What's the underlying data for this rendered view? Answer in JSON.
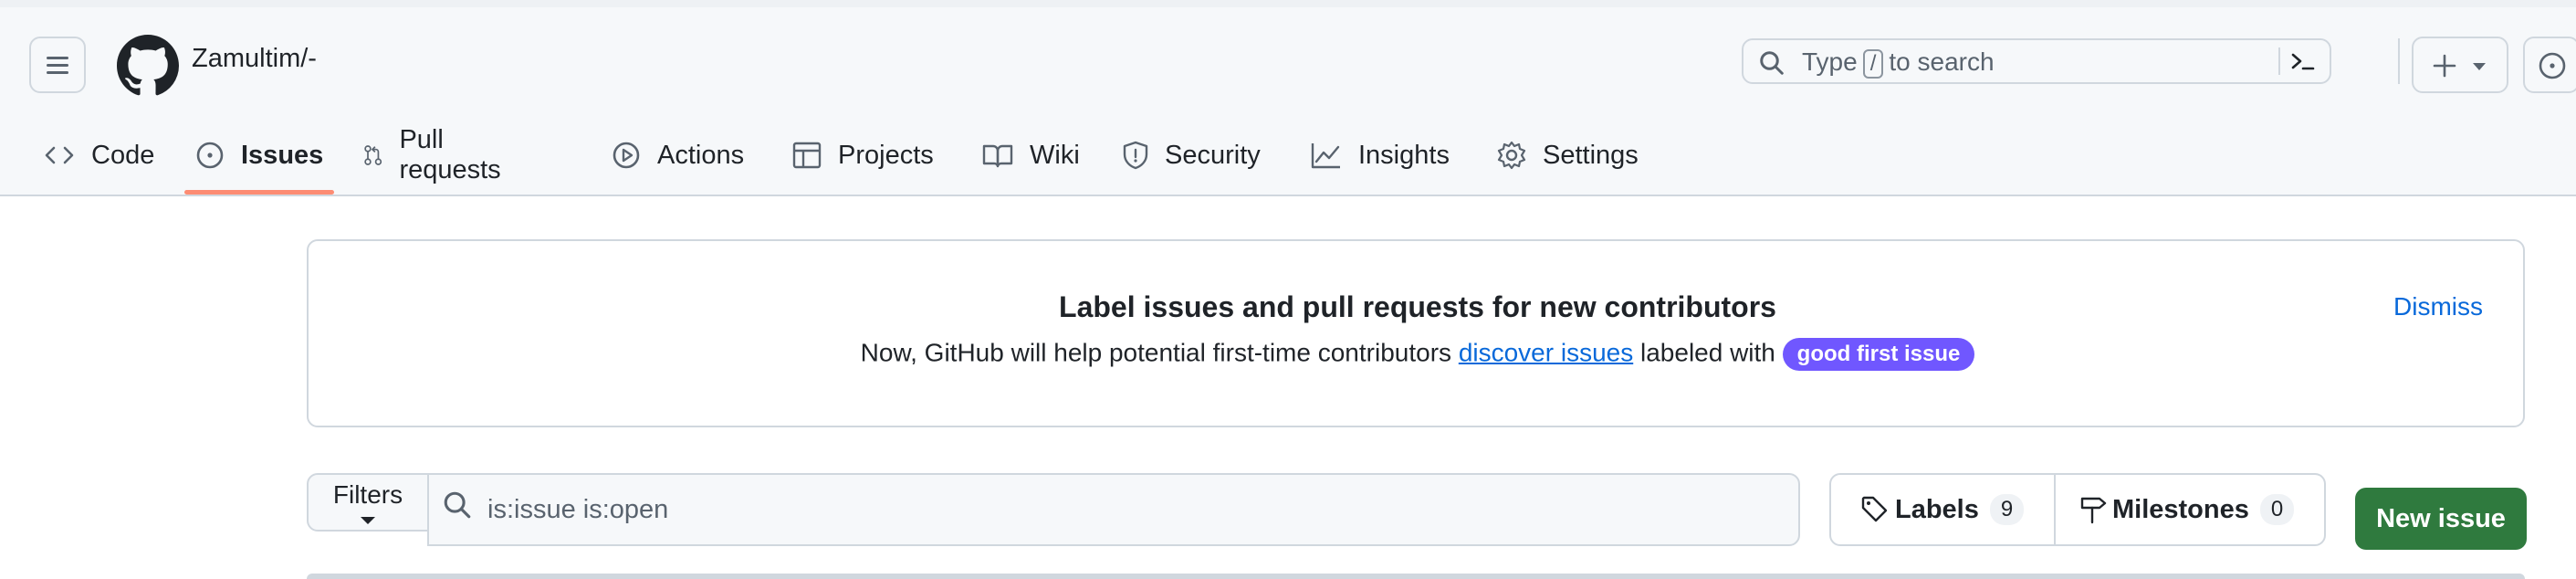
{
  "header": {
    "owner_repo": "Zamultim/-",
    "search": {
      "before": "Type",
      "key": "/",
      "after": "to search"
    }
  },
  "tabs": [
    {
      "label": "Code",
      "icon": "code-icon"
    },
    {
      "label": "Issues",
      "icon": "issue-opened-icon",
      "active": true
    },
    {
      "label": "Pull requests",
      "icon": "git-pull-request-icon"
    },
    {
      "label": "Actions",
      "icon": "play-icon"
    },
    {
      "label": "Projects",
      "icon": "table-icon"
    },
    {
      "label": "Wiki",
      "icon": "book-icon"
    },
    {
      "label": "Security",
      "icon": "shield-icon"
    },
    {
      "label": "Insights",
      "icon": "graph-icon"
    },
    {
      "label": "Settings",
      "icon": "gear-icon"
    }
  ],
  "banner": {
    "title": "Label issues and pull requests for new contributors",
    "body_before": "Now, GitHub will help potential first-time contributors",
    "link": "discover issues",
    "body_after": "labeled with",
    "label": "good first issue",
    "dismiss": "Dismiss"
  },
  "toolbar": {
    "filters": "Filters",
    "query": "is:issue is:open",
    "labels": "Labels",
    "labels_count": "9",
    "milestones": "Milestones",
    "milestones_count": "0",
    "new_issue": "New issue"
  },
  "colors": {
    "accent_underline": "#fd8c73",
    "link": "#0969da",
    "good_first_issue": "#7057ff",
    "primary_button": "#2f7a3e"
  }
}
